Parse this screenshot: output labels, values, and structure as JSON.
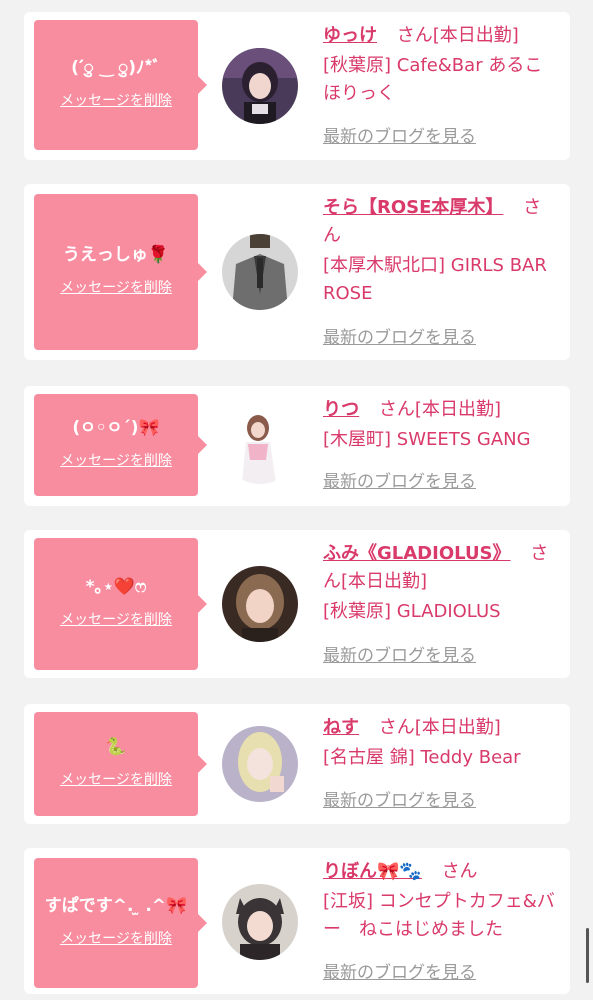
{
  "colors": {
    "accent": "#d93a6a",
    "bubble": "#f98da0",
    "muted": "#9a9a9a"
  },
  "delete_label": "メッセージを削除",
  "blog_label": "最新のブログを見る",
  "cards": [
    {
      "message": "(´ु ‿ ु)ﾉ*ﾞ",
      "name": "ゆっけ",
      "suffix": "さん[本日出勤]",
      "store": "[秋葉原] Cafe&Bar あるこほりっく",
      "avatar": "avatar-yukke"
    },
    {
      "message": "うえっしゅ🌹",
      "name": "そら【ROSE本厚木】",
      "suffix": "さん",
      "store": "[本厚木駅北口] GIRLS BAR ROSE",
      "avatar": "avatar-sora"
    },
    {
      "message": "(ㅇ◦ㅇ´)🎀",
      "name": "りつ",
      "suffix": "さん[本日出勤]",
      "store": "[木屋町] SWEETS GANG",
      "avatar": "avatar-ritsu"
    },
    {
      "message": "*｡⋆❤️ෆ",
      "name": "ふみ《GLADIOLUS》",
      "suffix": "さん[本日出勤]",
      "store": "[秋葉原] GLADIOLUS",
      "avatar": "avatar-fumi"
    },
    {
      "message": "🐍",
      "name": "ねす",
      "suffix": "さん[本日出勤]",
      "store": "[名古屋 錦] Teddy Bear",
      "avatar": "avatar-nesu"
    },
    {
      "message": "すぱです^. ̫ .^🎀",
      "name": "りぼん🎀🐾",
      "suffix": "さん",
      "store": "[江坂] コンセプトカフェ&バー　ねこはじめました",
      "avatar": "avatar-ribon"
    }
  ]
}
